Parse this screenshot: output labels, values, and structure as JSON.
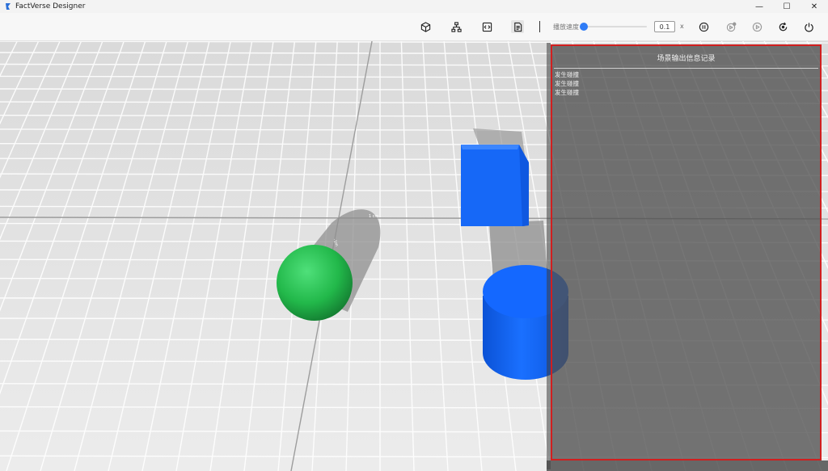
{
  "window": {
    "title": "FactVerse Designer",
    "controls": {
      "minimize": "—",
      "maximize": "☐",
      "close": "✕"
    }
  },
  "toolbar": {
    "buttons": [
      {
        "name": "cube-icon"
      },
      {
        "name": "hierarchy-icon"
      },
      {
        "name": "code-icon"
      },
      {
        "name": "document-icon",
        "active": true
      }
    ],
    "speed": {
      "label": "播放速度",
      "value": "0.1",
      "unit": "x",
      "slider_fraction": 0.05
    },
    "playback_buttons": [
      {
        "name": "pause-icon"
      },
      {
        "name": "step-settings-icon"
      },
      {
        "name": "play-icon"
      },
      {
        "name": "reset-icon"
      },
      {
        "name": "power-icon"
      }
    ]
  },
  "viewport": {
    "objects": [
      {
        "name": "green-sphere",
        "color": "#22b84a"
      },
      {
        "name": "blue-cube",
        "color": "#1565f5"
      },
      {
        "name": "blue-cylinder",
        "color": "#0f63f5"
      }
    ],
    "floor_color": "#e3e3e3"
  },
  "log_panel": {
    "title": "场景输出信息记录",
    "entries": [
      "发生碰撞",
      "发生碰撞",
      "发生碰撞"
    ],
    "border_color": "#d11f1f"
  }
}
